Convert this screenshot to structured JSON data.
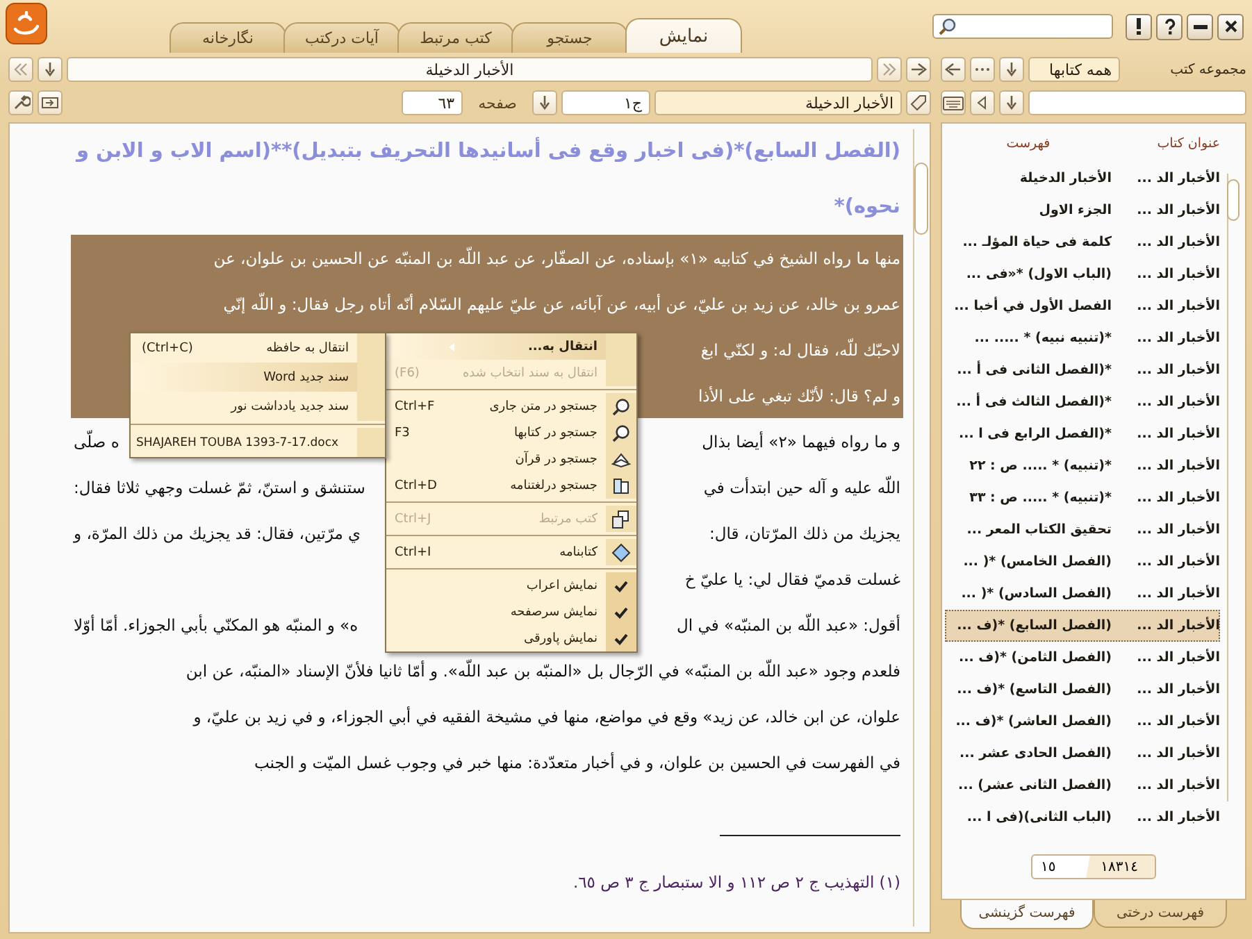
{
  "tabs": [
    {
      "label": "نمایش",
      "selected": true
    },
    {
      "label": "جستجو",
      "selected": false
    },
    {
      "label": "کتب مرتبط",
      "selected": false
    },
    {
      "label": "آیات درکتب",
      "selected": false
    },
    {
      "label": "نگارخانه",
      "selected": false
    }
  ],
  "reader": {
    "title": "الأخبار الدخيلة",
    "book": "الأخبار الدخيلة",
    "volume": "ج١",
    "page_label": "صفحه",
    "page": "٦٣"
  },
  "text": {
    "heading": [
      "(الفصل السابع)*(فى اخبار وقع فى أسانيدها التحريف بتبديل)**(اسم الاب و الابن و",
      "نحوه)*"
    ],
    "lines": [
      {
        "start": "منها ما رواه الشيخ في كتابيه «١» بإسناده، عن الصفّار، عن عبد اللّه بن المنبّه عن الحسين بن علوان، عن",
        "highlighted": true
      },
      {
        "start": "عمرو بن خالد، عن زيد بن عليّ، عن أبيه، عن آبائه، عن عليّ عليهم السّلام أنّه أتاه رجل فقال: و اللّه إنّي",
        "highlighted": true
      },
      {
        "start": "لاحبّك للّه، فقال له: و لكنّي ابغ",
        "highlighted": true
      },
      {
        "start": "و لم؟ قال: لأنّك تبغي على الأذا",
        "highlighted": true
      },
      {
        "start": "و ما رواه فيهما «٢» أيضا بذال",
        "end": "ه صلّى",
        "highlighted": false
      },
      {
        "start": "اللّه عليه و آله حين ابتدأت في",
        "end": "ستنشق و استنّ، ثمّ غسلت وجهي ثلاثا فقال:",
        "highlighted": false
      },
      {
        "start": "يجزيك من ذلك المرّتان، قال:",
        "end": "ي مرّتين، فقال: قد يجزيك من ذلك المرّة، و",
        "highlighted": false
      },
      {
        "start": "غسلت قدميّ فقال لي: يا عليّ خ",
        "highlighted": false
      },
      {
        "start": "أقول: «عبد اللّه بن المنبّه» في ال",
        "end": "ه» و المنبّه هو المكنّي بأبي الجوزاء. أمّا أوّلا",
        "highlighted": false
      },
      {
        "start": "فلعدم وجود «عبد اللّه بن المنبّه» في الرّجال بل «المنبّه بن عبد اللّه». و أمّا ثانيا فلأنّ الإسناد «المنبّه، عن ابن",
        "highlighted": false
      },
      {
        "start": "علوان، عن ابن خالد، عن زيد» وقع في مواضع، منها في مشيخة الفقيه في أبي الجوزاء، و في زيد بن عليّ، و",
        "highlighted": false
      },
      {
        "start": "في الفهرست في الحسين بن علوان، و في أخبار متعدّدة: منها خبر في وجوب غسل الميّت و الجنب",
        "highlighted": false
      }
    ],
    "footnote": "(١) التهذيب ج ٢ ص ١١٢ و الا ستبصار ج ٣ ص ٦٥."
  },
  "context_menu": {
    "items": [
      {
        "kind": "submenu",
        "label": "انتقال به...",
        "disabled": false,
        "selected": true
      },
      {
        "kind": "plain",
        "label": "انتقال به سند انتخاب شده",
        "shortcut": "(F6)",
        "disabled": true,
        "selected": false
      },
      {
        "kind": "separator"
      },
      {
        "kind": "search",
        "label": "جستجو در متن جاری",
        "shortcut": "Ctrl+F",
        "disabled": false,
        "selected": false
      },
      {
        "kind": "search",
        "label": "جستجو در کتابها",
        "shortcut": "F3",
        "disabled": false,
        "selected": false
      },
      {
        "kind": "quran",
        "label": "جستجو در قرآن",
        "disabled": false,
        "selected": false
      },
      {
        "kind": "dictionary",
        "label": "جستجو درلغتنامه",
        "shortcut": "Ctrl+D",
        "disabled": false,
        "selected": false
      },
      {
        "kind": "separator"
      },
      {
        "kind": "related",
        "label": "کتب مرتبط",
        "shortcut": "Ctrl+J",
        "disabled": true,
        "selected": false
      },
      {
        "kind": "separator"
      },
      {
        "kind": "bibliography",
        "label": "کتابنامه",
        "shortcut": "Ctrl+I",
        "disabled": false,
        "selected": false
      },
      {
        "kind": "separator"
      },
      {
        "kind": "check",
        "label": "نمایش اعراب",
        "checked": true,
        "disabled": false,
        "selected": false
      },
      {
        "kind": "check",
        "label": "نمایش سرصفحه",
        "checked": true,
        "disabled": false,
        "selected": false
      },
      {
        "kind": "check",
        "label": "نمایش پاورقی",
        "checked": true,
        "disabled": false,
        "selected": false
      }
    ]
  },
  "submenu": {
    "items": [
      {
        "kind": "plain",
        "label": "انتقال به حافظه",
        "shortcut": "(Ctrl+C)",
        "selected": false
      },
      {
        "kind": "plain",
        "label": "سند جدید Word",
        "selected": true
      },
      {
        "kind": "plain",
        "label": "سند جدید یادداشت نور",
        "selected": false
      },
      {
        "kind": "separator"
      },
      {
        "kind": "file",
        "label": "SHAJAREH TOUBA  1393-7-17.docx",
        "selected": false
      }
    ]
  },
  "sidebar": {
    "collection_label": "مجموعه کتب",
    "collection": "همه کتابها",
    "columns": [
      "عنوان کتاب",
      "فهرست"
    ],
    "rows": [
      {
        "book": "الأخبار الد ...",
        "entry": "الأخبار الدخيلة",
        "selected": false
      },
      {
        "book": "الأخبار الد ...",
        "entry": "الجزء الاول",
        "selected": false
      },
      {
        "book": "الأخبار الد ...",
        "entry": "كلمة فى حياة المؤلـ ...",
        "selected": false
      },
      {
        "book": "الأخبار الد ...",
        "entry": "(الباب الاول) *«فى ...",
        "selected": false
      },
      {
        "book": "الأخبار الد ...",
        "entry": "الفصل الأول في أخبا ...",
        "selected": false
      },
      {
        "book": "الأخبار الد ...",
        "entry": "*(تنبيه نبيه) * ..... ...",
        "selected": false
      },
      {
        "book": "الأخبار الد ...",
        "entry": "*(الفصل الثانى فى أ ...",
        "selected": false
      },
      {
        "book": "الأخبار الد ...",
        "entry": "*(الفصل الثالث فى أ ...",
        "selected": false
      },
      {
        "book": "الأخبار الد ...",
        "entry": "*(الفصل الرابع فى ا ...",
        "selected": false
      },
      {
        "book": "الأخبار الد ...",
        "entry": "*(تنبيه) * ..... ص : ٢٢",
        "selected": false
      },
      {
        "book": "الأخبار الد ...",
        "entry": "*(تنبيه) * ..... ص : ٣٣",
        "selected": false
      },
      {
        "book": "الأخبار الد ...",
        "entry": "تحقيق الكتاب المعر ...",
        "selected": false
      },
      {
        "book": "الأخبار الد ...",
        "entry": "(الفصل الخامس) *( ...",
        "selected": false
      },
      {
        "book": "الأخبار الد ...",
        "entry": "(الفصل السادس) *( ...",
        "selected": false
      },
      {
        "book": "الأخبار الد ...",
        "entry": "(الفصل السابع) *(ف ...",
        "selected": true
      },
      {
        "book": "الأخبار الد ...",
        "entry": "(الفصل الثامن) *(ف ...",
        "selected": false
      },
      {
        "book": "الأخبار الد ...",
        "entry": "(الفصل التاسع) *(ف ...",
        "selected": false
      },
      {
        "book": "الأخبار الد ...",
        "entry": "(الفصل العاشر) *(ف ...",
        "selected": false
      },
      {
        "book": "الأخبار الد ...",
        "entry": "(الفصل الحادى عشر ...",
        "selected": false
      },
      {
        "book": "الأخبار الد ...",
        "entry": "(الفصل الثانى عشر) ...",
        "selected": false
      },
      {
        "book": "الأخبار الد ...",
        "entry": "(الباب الثانى)(فى ا ...",
        "selected": false
      }
    ],
    "total": "١٨٣١٤",
    "current": "١٥",
    "tabs": [
      {
        "label": "فهرست درختی",
        "selected": false
      },
      {
        "label": "فهرست گزینشی",
        "selected": true
      }
    ]
  }
}
